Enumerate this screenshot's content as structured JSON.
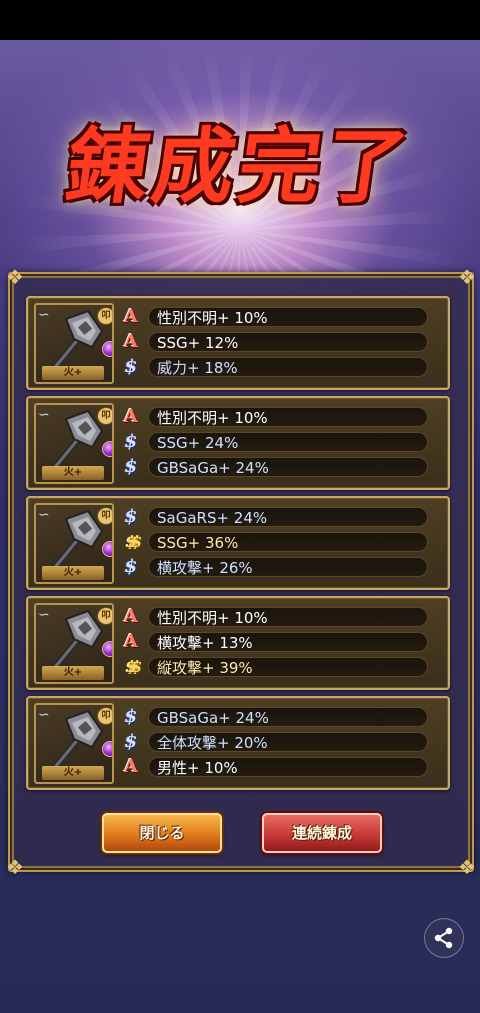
{
  "screen": {
    "title": "錬成完了",
    "close_label": "閉じる",
    "repeat_label": "連続錬成",
    "share_icon": "share-icon"
  },
  "cards": [
    {
      "weapon_tag": "火+",
      "attr_badge": "叩",
      "stats": [
        {
          "rank": "A",
          "text": "性別不明+ 10%"
        },
        {
          "rank": "A",
          "text": "SSG+ 12%"
        },
        {
          "rank": "S",
          "text": "威力+ 18%"
        }
      ]
    },
    {
      "weapon_tag": "火+",
      "attr_badge": "叩",
      "stats": [
        {
          "rank": "A",
          "text": "性別不明+ 10%"
        },
        {
          "rank": "S",
          "text": "SSG+ 24%"
        },
        {
          "rank": "S",
          "text": "GBSaGa+ 24%"
        }
      ]
    },
    {
      "weapon_tag": "火+",
      "attr_badge": "叩",
      "stats": [
        {
          "rank": "S",
          "text": "SaGaRS+ 24%"
        },
        {
          "rank": "SS",
          "text": "SSG+ 36%"
        },
        {
          "rank": "S",
          "text": "横攻撃+ 26%"
        }
      ]
    },
    {
      "weapon_tag": "火+",
      "attr_badge": "叩",
      "stats": [
        {
          "rank": "A",
          "text": "性別不明+ 10%"
        },
        {
          "rank": "A",
          "text": "横攻撃+ 13%"
        },
        {
          "rank": "SS",
          "text": "縦攻撃+ 39%"
        }
      ]
    },
    {
      "weapon_tag": "火+",
      "attr_badge": "叩",
      "stats": [
        {
          "rank": "S",
          "text": "GBSaGa+ 24%"
        },
        {
          "rank": "S",
          "text": "全体攻撃+ 20%"
        },
        {
          "rank": "A",
          "text": "男性+ 10%"
        }
      ]
    }
  ],
  "rank_glyphs": {
    "A": "A",
    "S": "$",
    "SS": "$$"
  },
  "colors": {
    "panel_border": "#b99956",
    "title_red": "#ff3a20",
    "close_button": "#e07a1d",
    "repeat_button": "#c73a36"
  }
}
